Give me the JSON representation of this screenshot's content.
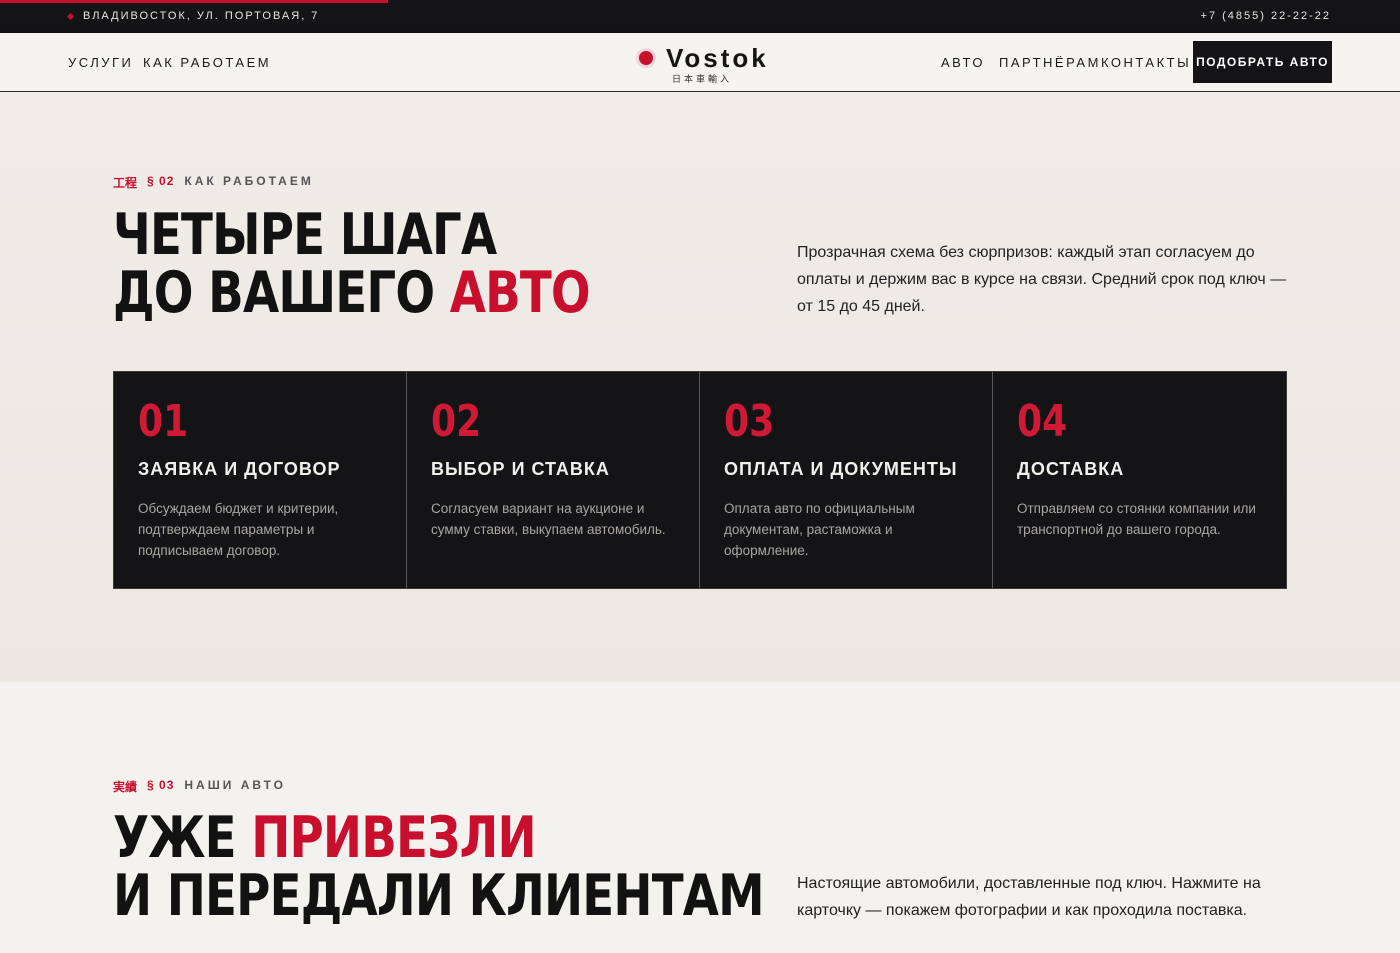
{
  "topbar": {
    "address": "ВЛАДИВОСТОК, УЛ. ПОРТОВАЯ, 7",
    "phone": "+7 (4855) 22-22-22"
  },
  "nav": {
    "left": [
      "УСЛУГИ",
      "КАК РАБОТАЕМ"
    ],
    "right": [
      "АВТО",
      "ПАРТНЁРАМ",
      "КОНТАКТЫ"
    ],
    "cta": "ПОДОБРАТЬ АВТО",
    "logo": {
      "word": "Vostok",
      "kanji": "日本車輸入"
    }
  },
  "how": {
    "eyebrow": {
      "kanji": "工程",
      "num": "§ 02",
      "label": "КАК РАБОТАЕМ"
    },
    "headline_line1": "ЧЕТЫРЕ ШАГА",
    "headline_line2": "ДО ВАШЕГО",
    "headline_accent": "АВТО",
    "lead": "Прозрачная схема без сюрпризов: каждый этап согласуем до оплаты и держим вас в курсе на связи. Средний срок под ключ — от 15 до 45 дней.",
    "steps": [
      {
        "num": "01",
        "title": "ЗАЯВКА И ДОГОВОР",
        "desc": "Обсуждаем бюджет и критерии, подтверждаем параметры и подписываем договор."
      },
      {
        "num": "02",
        "title": "ВЫБОР И СТАВКА",
        "desc": "Согласуем вариант на аукционе и сумму ставки, выкупаем автомобиль."
      },
      {
        "num": "03",
        "title": "ОПЛАТА И ДОКУМЕНТЫ",
        "desc": "Оплата авто по официальным документам, растаможка и оформление."
      },
      {
        "num": "04",
        "title": "ДОСТАВКА",
        "desc": "Отправляем со стоянки компании или транспортной до вашего города."
      }
    ]
  },
  "cars": {
    "eyebrow": {
      "kanji": "実績",
      "num": "§ 03",
      "label": "НАШИ АВТО"
    },
    "headline_plain": "УЖЕ",
    "headline_accent": "ПРИВЕЗЛИ",
    "headline_line2": "И ПЕРЕДАЛИ КЛИЕНТАМ",
    "lead": "Настоящие автомобили, доставленные под ключ. Нажмите на карточку — покажем фотографии и как проходила поставка."
  },
  "colors": {
    "accent": "#c8102e",
    "dark": "#141417",
    "bg": "#f4f2ee"
  }
}
